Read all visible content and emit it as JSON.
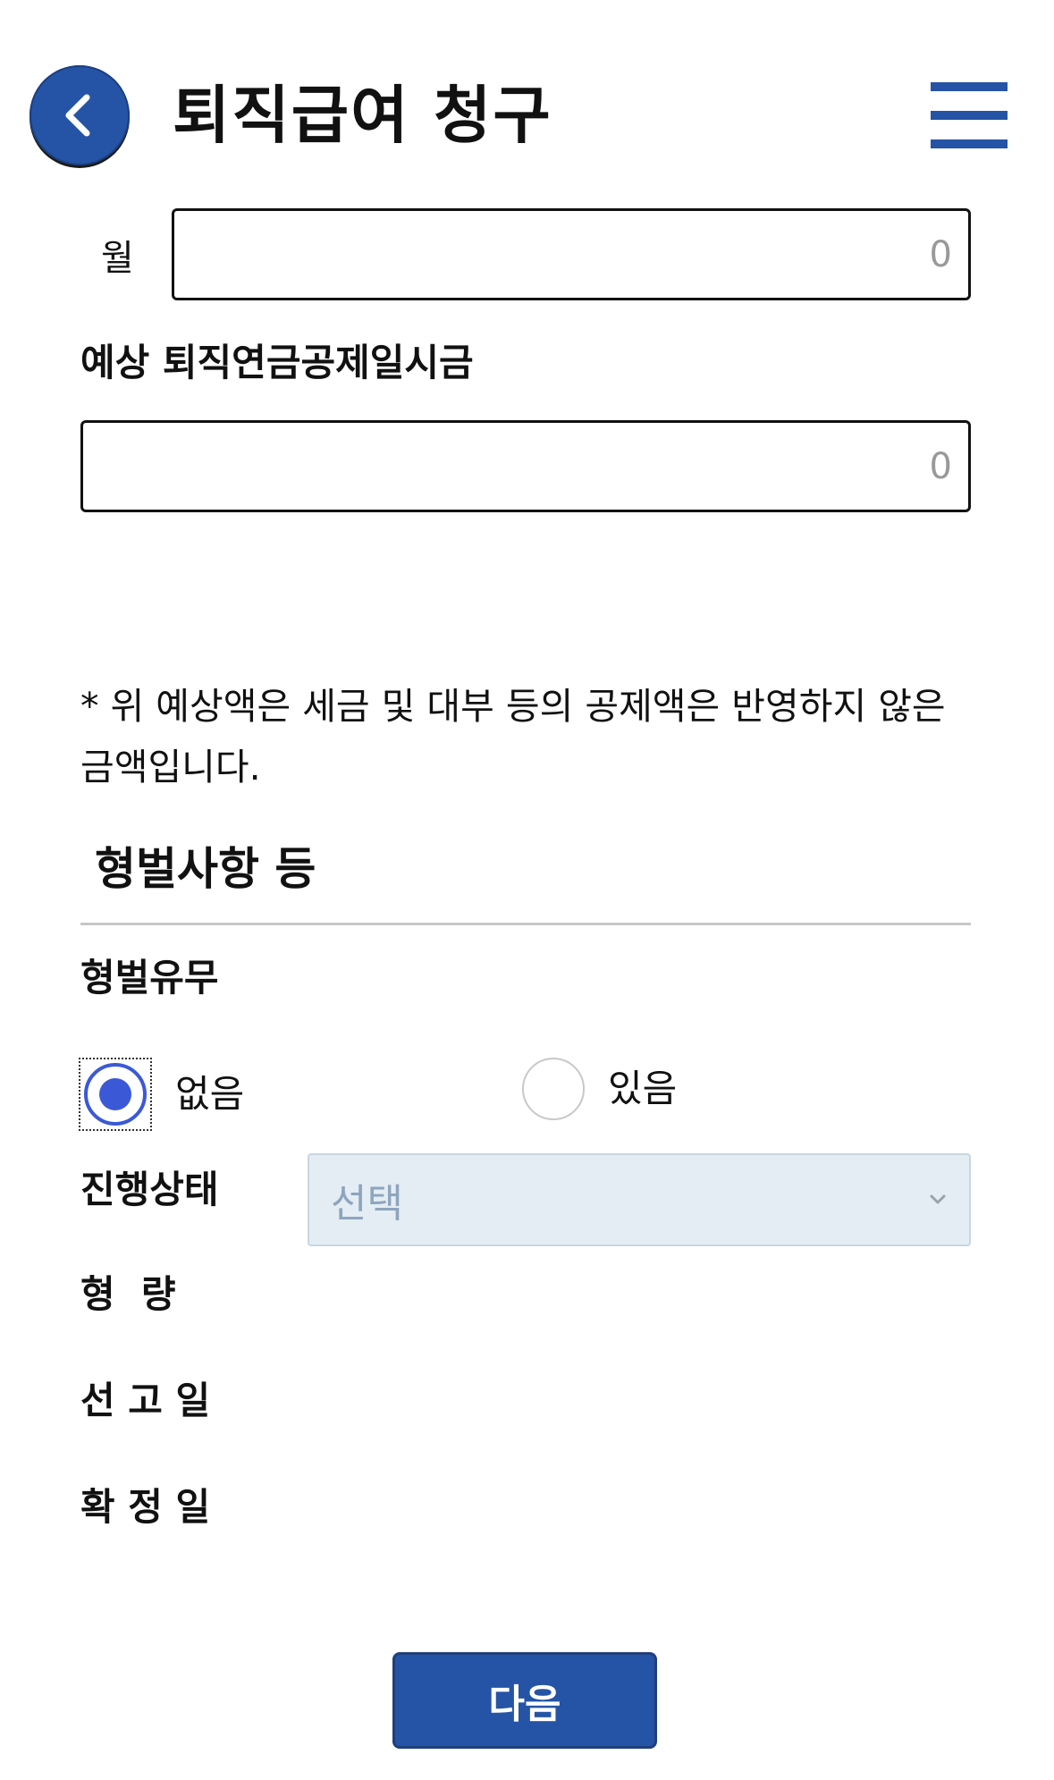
{
  "header": {
    "title": "퇴직급여 청구",
    "back_icon": "chevron-left-icon",
    "menu_icon": "hamburger-menu-icon",
    "accent_color": "#2554a6"
  },
  "form": {
    "month_label": "월",
    "month_placeholder": "0",
    "pension_lump_label": "예상 퇴직연금공제일시금",
    "pension_lump_placeholder": "0",
    "notice": "* 위 예상액은 세금 및 대부 등의 공제액은 반영하지 않은 금액입니다."
  },
  "criminal": {
    "section_title": "형벌사항 등",
    "has_penalty_label": "형벌유무",
    "options": [
      {
        "label": "없음",
        "checked": true
      },
      {
        "label": "있음",
        "checked": false
      }
    ],
    "status_label": "진행상태",
    "status_select_value": "선택",
    "sentence_label": "형  량",
    "sentence_date_label": "선 고 일",
    "confirm_date_label": "확 정 일"
  },
  "footer": {
    "next_label": "다음"
  }
}
